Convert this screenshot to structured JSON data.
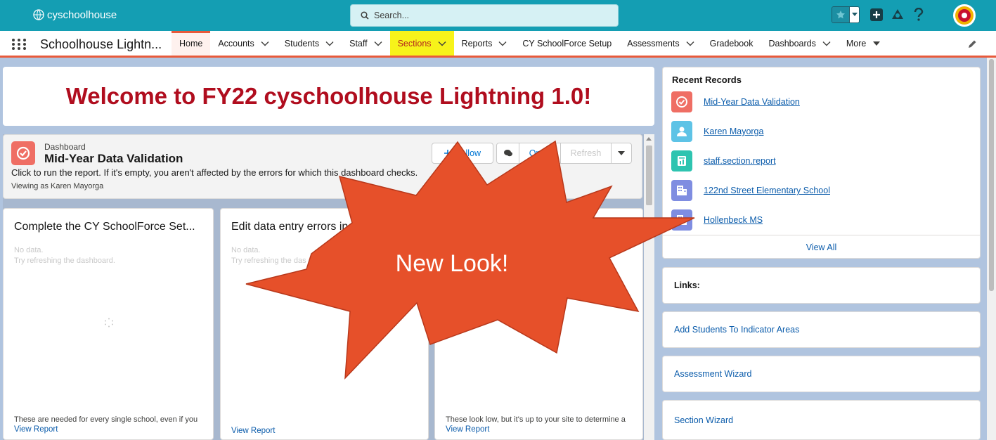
{
  "header": {
    "brand": "cyschoolhouse",
    "search_placeholder": "Search..."
  },
  "nav": {
    "app_name": "Schoolhouse Lightn...",
    "items": [
      {
        "label": "Home",
        "dropdown": false
      },
      {
        "label": "Accounts",
        "dropdown": true
      },
      {
        "label": "Students",
        "dropdown": true
      },
      {
        "label": "Staff",
        "dropdown": true
      },
      {
        "label": "Sections",
        "dropdown": true
      },
      {
        "label": "Reports",
        "dropdown": true
      },
      {
        "label": "CY SchoolForce Setup",
        "dropdown": false
      },
      {
        "label": "Assessments",
        "dropdown": true
      },
      {
        "label": "Gradebook",
        "dropdown": false
      },
      {
        "label": "Dashboards",
        "dropdown": true
      },
      {
        "label": "More",
        "dropdown": true
      }
    ]
  },
  "welcome": "Welcome to FY22 cyschoolhouse Lightning 1.0!",
  "dashboard": {
    "kicker": "Dashboard",
    "title": "Mid-Year Data Validation",
    "description": "Click to run the report. If it's empty, you aren't affected by the errors for which this dashboard checks.",
    "viewing_as": "Viewing as Karen Mayorga",
    "follow": "Follow",
    "open": "Open",
    "refresh": "Refresh"
  },
  "cards": [
    {
      "title": "Complete the CY SchoolForce Set...",
      "nodata": "No data.",
      "hint": "Try refreshing the dashboard.",
      "footer": "These are needed for every single school, even if you",
      "link": "View Report"
    },
    {
      "title": "Edit data entry errors in se",
      "nodata": "No data.",
      "hint": "Try refreshing the das",
      "footer": "",
      "link": "View Report"
    },
    {
      "title": "",
      "nodata": "",
      "hint": "",
      "footer": "These look low, but it's up to your site to determine a",
      "link": "View Report"
    }
  ],
  "recent": {
    "title": "Recent Records",
    "items": [
      {
        "label": "Mid-Year Data Validation",
        "icon": "dashboard-icon",
        "color": "#ef6e64"
      },
      {
        "label": "Karen Mayorga",
        "icon": "user-icon",
        "color": "#5ec3e6"
      },
      {
        "label": "staff.section.report",
        "icon": "report-icon",
        "color": "#2ec4b0"
      },
      {
        "label": "122nd Street Elementary School",
        "icon": "building-icon",
        "color": "#7f8de1"
      },
      {
        "label": "Hollenbeck MS",
        "icon": "building-icon",
        "color": "#7f8de1"
      }
    ],
    "view_all": "View All"
  },
  "links": {
    "heading": "Links:",
    "items": [
      "Add Students To Indicator Areas",
      "Assessment Wizard",
      "Section Wizard"
    ]
  },
  "callout": "New Look!",
  "colors": {
    "header": "#149eb3",
    "accent": "#e85a3b",
    "starburst": "#e6502a",
    "welcome_text": "#b00d1e",
    "highlight": "#f7f31a"
  }
}
